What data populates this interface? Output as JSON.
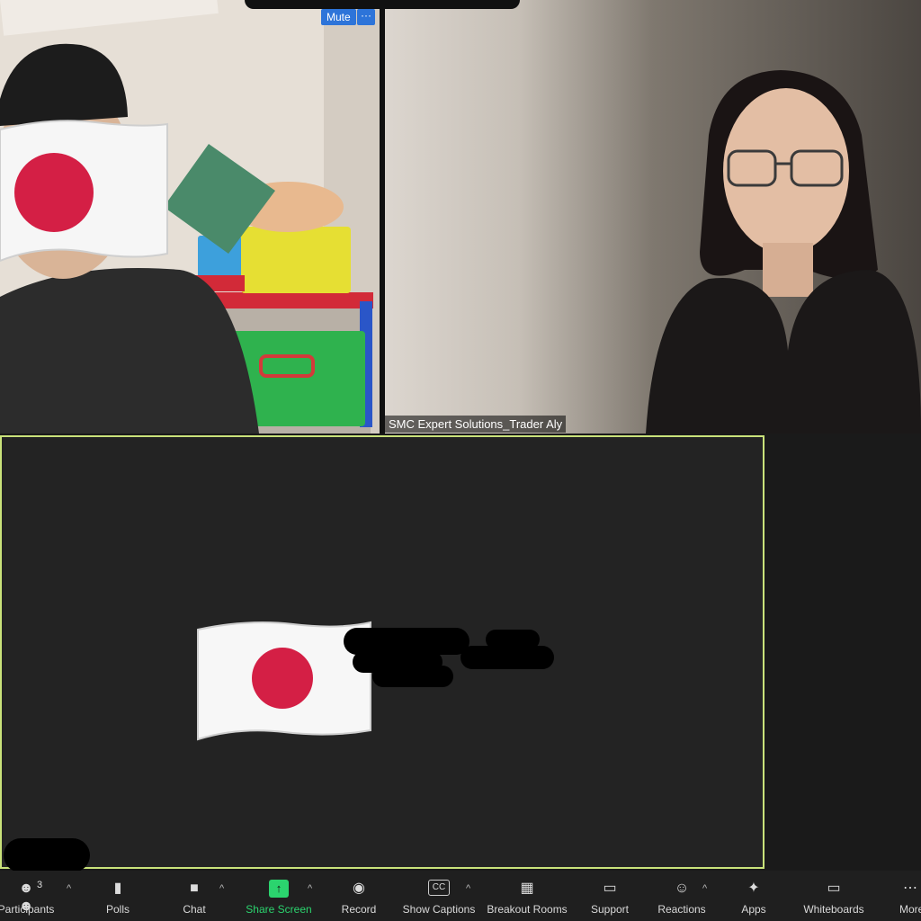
{
  "top_left_tile": {
    "mute_label": "Mute",
    "more_label": "···"
  },
  "top_right_tile": {
    "participant_name": "SMC Expert Solutions_Trader Aly"
  },
  "toolbar": {
    "items": [
      {
        "label": "Participants",
        "badge": "3",
        "icon": "participants-icon"
      },
      {
        "label": "Polls",
        "icon": "polls-icon"
      },
      {
        "label": "Chat",
        "icon": "chat-icon"
      },
      {
        "label": "Share Screen",
        "icon": "share-screen-icon",
        "color": "#2bd46e"
      },
      {
        "label": "Record",
        "icon": "record-icon"
      },
      {
        "label": "Show Captions",
        "icon": "captions-icon"
      },
      {
        "label": "Breakout Rooms",
        "icon": "breakout-rooms-icon"
      },
      {
        "label": "Support",
        "icon": "support-icon"
      },
      {
        "label": "Reactions",
        "icon": "reactions-icon"
      },
      {
        "label": "Apps",
        "icon": "apps-icon"
      },
      {
        "label": "Whiteboards",
        "icon": "whiteboards-icon"
      },
      {
        "label": "More",
        "icon": "more-icon"
      }
    ]
  },
  "colors": {
    "active_speaker_border": "#c9e27a",
    "share_green": "#2bd46e",
    "button_blue": "#2d74d9"
  }
}
